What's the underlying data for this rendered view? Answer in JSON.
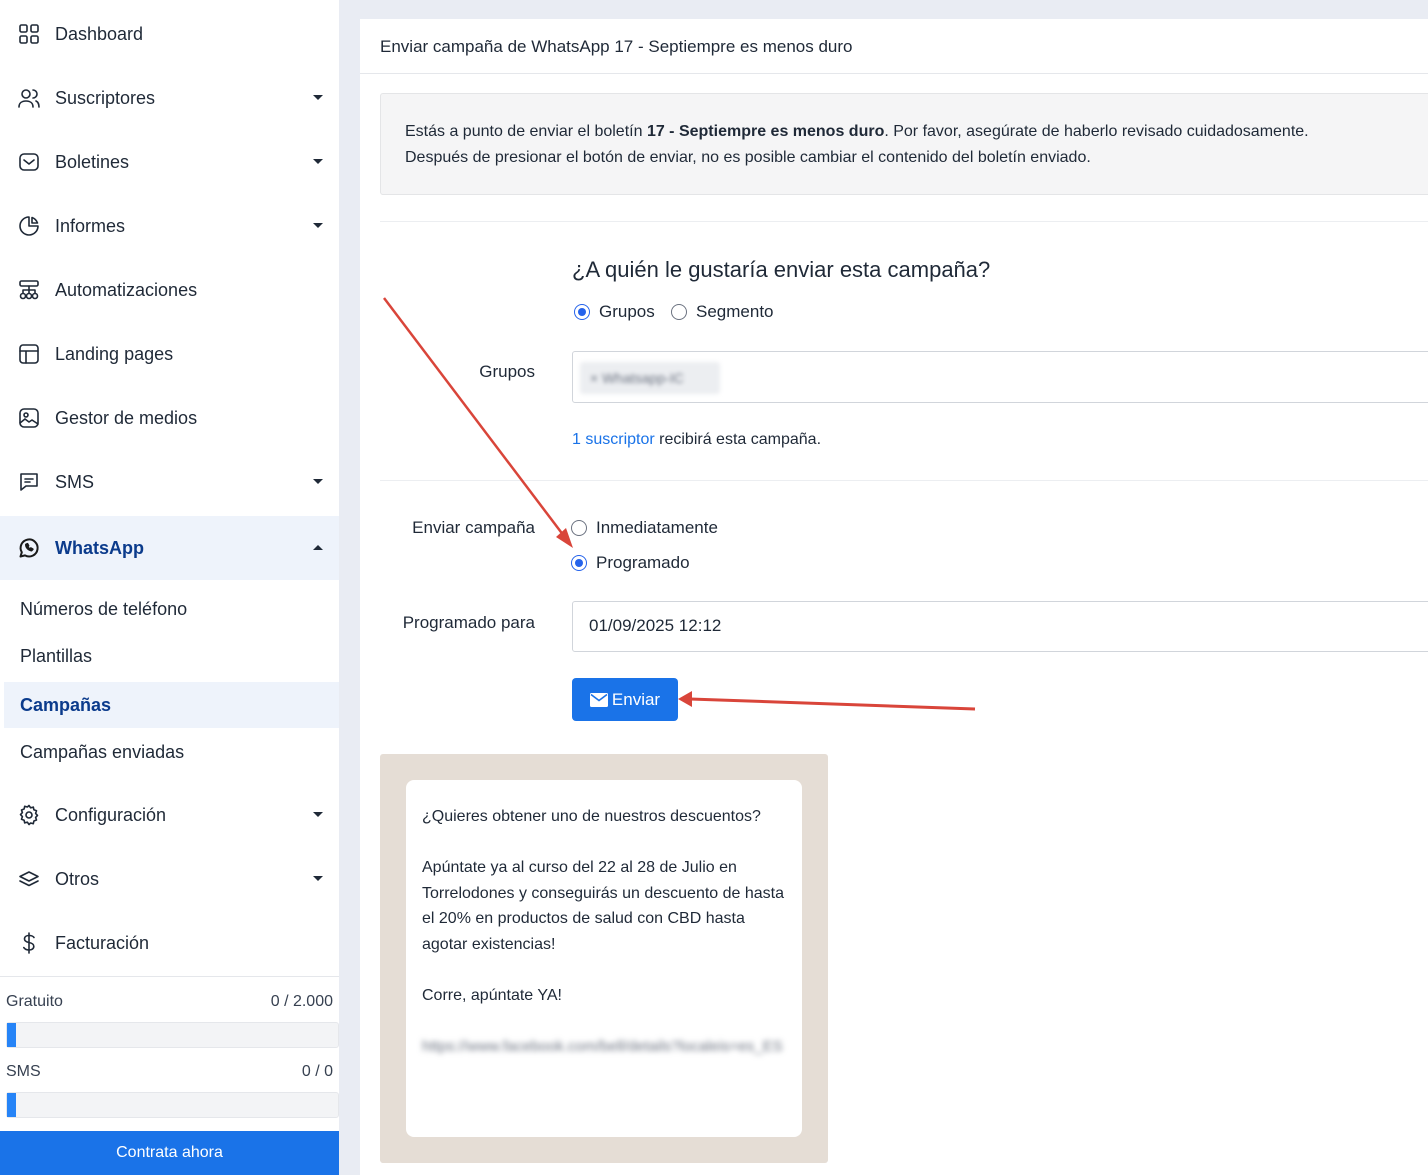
{
  "sidebar": {
    "items": [
      {
        "label": "Dashboard",
        "icon": "dashboard-grid-icon"
      },
      {
        "label": "Suscriptores",
        "icon": "users-icon"
      },
      {
        "label": "Boletines",
        "icon": "envelope-icon"
      },
      {
        "label": "Informes",
        "icon": "pie-chart-icon"
      },
      {
        "label": "Automatizaciones",
        "icon": "flow-icon"
      },
      {
        "label": "Landing pages",
        "icon": "layout-icon"
      },
      {
        "label": "Gestor de medios",
        "icon": "image-icon"
      },
      {
        "label": "SMS",
        "icon": "message-icon"
      },
      {
        "label": "WhatsApp",
        "icon": "whatsapp-icon"
      },
      {
        "label": "Configuración",
        "icon": "gear-icon"
      },
      {
        "label": "Otros",
        "icon": "layers-icon"
      },
      {
        "label": "Facturación",
        "icon": "dollar-icon"
      }
    ],
    "whatsapp_sub": [
      "Números de teléfono",
      "Plantillas",
      "Campañas",
      "Campañas enviadas"
    ],
    "usage": [
      {
        "label": "Gratuito",
        "value": "0 / 2.000"
      },
      {
        "label": "SMS",
        "value": "0 / 0"
      }
    ],
    "cta_label": "Contrata ahora",
    "accent": "#1a73e8"
  },
  "main": {
    "title": "Enviar campaña de WhatsApp 17 - Septiempre es menos duro",
    "alert": {
      "prefix": "Estás a punto de enviar el boletín ",
      "bold": "17 - Septiempre es menos duro",
      "suffix": ". Por favor, asegúrate de haberlo revisado cuidadosamente.",
      "line2": "Después de presionar el botón de enviar, no es posible cambiar el contenido del boletín enviado."
    },
    "question": "¿A quién le gustaría enviar esta campaña?",
    "audience_options": [
      "Grupos",
      "Segmento"
    ],
    "groups_label": "Grupos",
    "group_chip": "× Whatsapp-IC",
    "subscriber_link": "1 suscriptor",
    "subscriber_suffix": " recibirá esta campaña.",
    "send_label": "Enviar campaña",
    "send_options": [
      "Inmediatamente",
      "Programado"
    ],
    "scheduled_label": "Programado para",
    "scheduled_value": "01/09/2025 12:12",
    "send_button": "Enviar",
    "message": {
      "p1": "¿Quieres obtener uno de nuestros descuentos?",
      "p2": "Apúntate ya al curso del 22 al 28 de Julio en Torrelodones y conseguirás un descuento de hasta el 20% en productos de salud con CBD hasta agotar existencias!",
      "p3": "Corre, apúntate YA!",
      "link": "https://www.facebook.com/bell/details?localeis=es_ES"
    }
  }
}
